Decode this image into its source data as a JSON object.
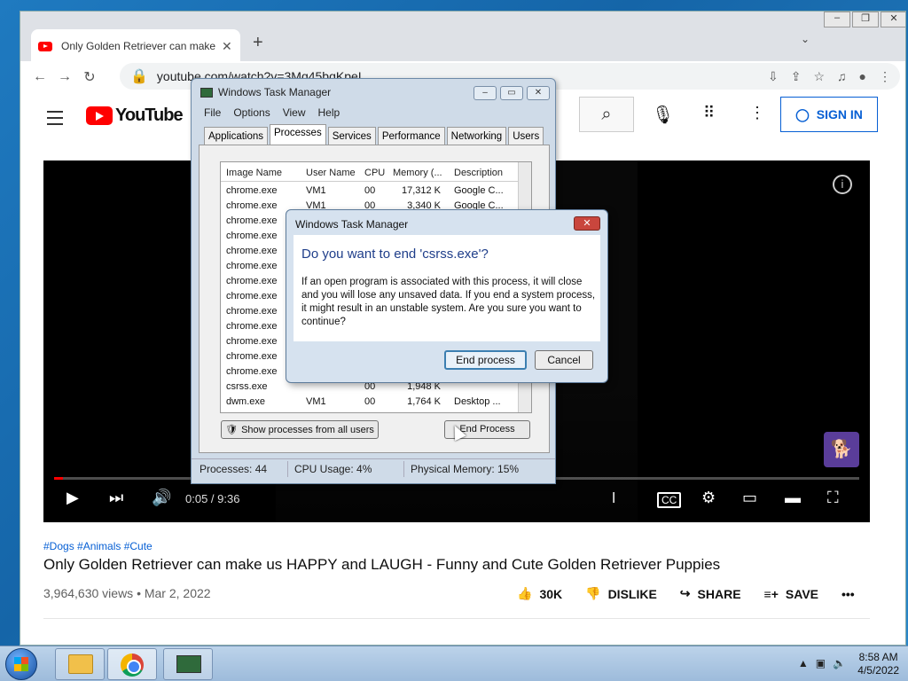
{
  "browser": {
    "tab_title": "Only Golden Retriever can make",
    "url": "youtube.com/watch?v=3Mq45bqKpeI"
  },
  "youtube": {
    "logo_text": "YouTube",
    "signin_label": "SIGN IN",
    "player_time": "0:05 / 9:36",
    "progress_fraction": 0.009,
    "hashtags": "#Dogs #Animals #Cute",
    "video_title": "Only Golden Retriever can make us HAPPY and LAUGH - Funny and Cute Golden Retriever Puppies",
    "views_date": "3,964,630 views • Mar 2, 2022",
    "like_count": "30K",
    "dislike_label": "DISLIKE",
    "share_label": "SHARE",
    "save_label": "SAVE"
  },
  "task_manager": {
    "title": "Windows Task Manager",
    "menu": [
      "File",
      "Options",
      "View",
      "Help"
    ],
    "tabs": [
      "Applications",
      "Processes",
      "Services",
      "Performance",
      "Networking",
      "Users"
    ],
    "active_tab": "Processes",
    "columns": [
      "Image Name",
      "User Name",
      "CPU",
      "Memory (...",
      "Description"
    ],
    "rows": [
      {
        "name": "chrome.exe",
        "user": "VM1",
        "cpu": "00",
        "mem": "17,312 K",
        "desc": "Google C..."
      },
      {
        "name": "chrome.exe",
        "user": "VM1",
        "cpu": "00",
        "mem": "3,340 K",
        "desc": "Google C..."
      },
      {
        "name": "chrome.exe",
        "user": "",
        "cpu": "",
        "mem": "",
        "desc": ""
      },
      {
        "name": "chrome.exe",
        "user": "",
        "cpu": "",
        "mem": "",
        "desc": ""
      },
      {
        "name": "chrome.exe",
        "user": "",
        "cpu": "",
        "mem": "",
        "desc": ""
      },
      {
        "name": "chrome.exe",
        "user": "",
        "cpu": "",
        "mem": "",
        "desc": ""
      },
      {
        "name": "chrome.exe",
        "user": "",
        "cpu": "",
        "mem": "",
        "desc": ""
      },
      {
        "name": "chrome.exe",
        "user": "",
        "cpu": "",
        "mem": "",
        "desc": ""
      },
      {
        "name": "chrome.exe",
        "user": "",
        "cpu": "",
        "mem": "",
        "desc": ""
      },
      {
        "name": "chrome.exe",
        "user": "",
        "cpu": "",
        "mem": "",
        "desc": ""
      },
      {
        "name": "chrome.exe",
        "user": "",
        "cpu": "",
        "mem": "",
        "desc": ""
      },
      {
        "name": "chrome.exe",
        "user": "",
        "cpu": "",
        "mem": "",
        "desc": ""
      },
      {
        "name": "chrome.exe",
        "user": "",
        "cpu": "",
        "mem": "",
        "desc": ""
      },
      {
        "name": "csrss.exe",
        "user": "",
        "cpu": "00",
        "mem": "1,948 K",
        "desc": ""
      },
      {
        "name": "dwm.exe",
        "user": "VM1",
        "cpu": "00",
        "mem": "1,764 K",
        "desc": "Desktop ..."
      }
    ],
    "show_all_label": "Show processes from all users",
    "end_process_label": "End Process",
    "status": {
      "processes": "Processes: 44",
      "cpu": "CPU Usage: 4%",
      "memory": "Physical Memory: 15%"
    }
  },
  "dialog": {
    "title": "Windows Task Manager",
    "question": "Do you want to end 'csrss.exe'?",
    "message": "If an open program is associated with this process, it will close and you will lose any unsaved data. If you end a system process, it might result in an unstable system. Are you sure you want to continue?",
    "end_label": "End process",
    "cancel_label": "Cancel"
  },
  "taskbar": {
    "time": "8:58 AM",
    "date": "4/5/2022"
  },
  "colors": {
    "youtube_red": "#ff0000",
    "signin_blue": "#065fd4",
    "dialog_heading": "#1f3e8a"
  }
}
